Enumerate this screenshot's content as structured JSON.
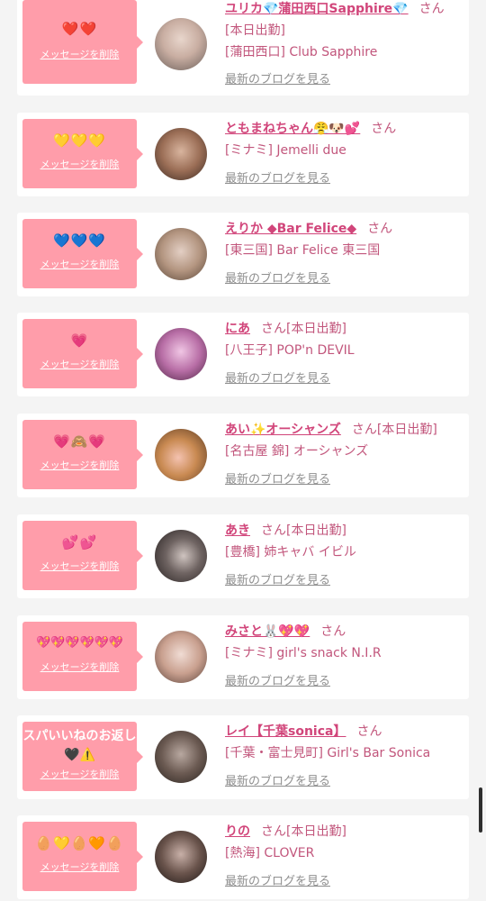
{
  "delete_label": "メッセージを削除",
  "san_label": "さん",
  "blog_label": "最新のブログを見る",
  "today_tag": "[本日出勤]",
  "cards": [
    {
      "msg": "❤️❤️",
      "name": "ユリカ💎蒲田西口Sapphire💎",
      "store": "[蒲田西口] Club Sapphire",
      "tag_inline": false,
      "tag_below": true
    },
    {
      "msg": "💛💛💛",
      "name": "ともまねちゃん😤🐶💕",
      "store": "[ミナミ] Jemelli due",
      "tag_inline": false,
      "tag_below": false
    },
    {
      "msg": "💙💙💙",
      "name": "えりか ◆Bar Felice◆",
      "store": "[東三国] Bar Felice 東三国",
      "tag_inline": false,
      "tag_below": false
    },
    {
      "msg": "💗",
      "name": "にあ",
      "store": "[八王子] POP'n DEVIL",
      "tag_inline": true,
      "tag_below": false
    },
    {
      "msg": "💗🙈💗",
      "name": "あい✨オーシャンズ",
      "store": "[名古屋 錦] オーシャンズ",
      "tag_inline": true,
      "tag_below": false
    },
    {
      "msg": "💕💕",
      "name": "あき",
      "store": "[豊橋] 姉キャバ イビル",
      "tag_inline": true,
      "tag_below": false
    },
    {
      "msg": "💖💖💖💖💖💖",
      "name": "みさと🐰💖💖",
      "store": "[ミナミ] girl's snack N.I.R",
      "tag_inline": false,
      "tag_below": false
    },
    {
      "msg": "スパいいねのお返し🖤⚠️",
      "name": "レイ【千葉sonica】",
      "store": "[千葉・富士見町] Girl's Bar Sonica",
      "tag_inline": false,
      "tag_below": false
    },
    {
      "msg": "🥚💛🥚🧡🥚",
      "name": "りの",
      "store": "[熱海] CLOVER",
      "tag_inline": true,
      "tag_below": false
    }
  ],
  "avatar_colors": [
    "#d9c4bd",
    "#7a5040",
    "#b89a86",
    "#b86ea6",
    "#c98a52",
    "#4a4040",
    "#c9a08f",
    "#6b5a52",
    "#3f332e"
  ]
}
